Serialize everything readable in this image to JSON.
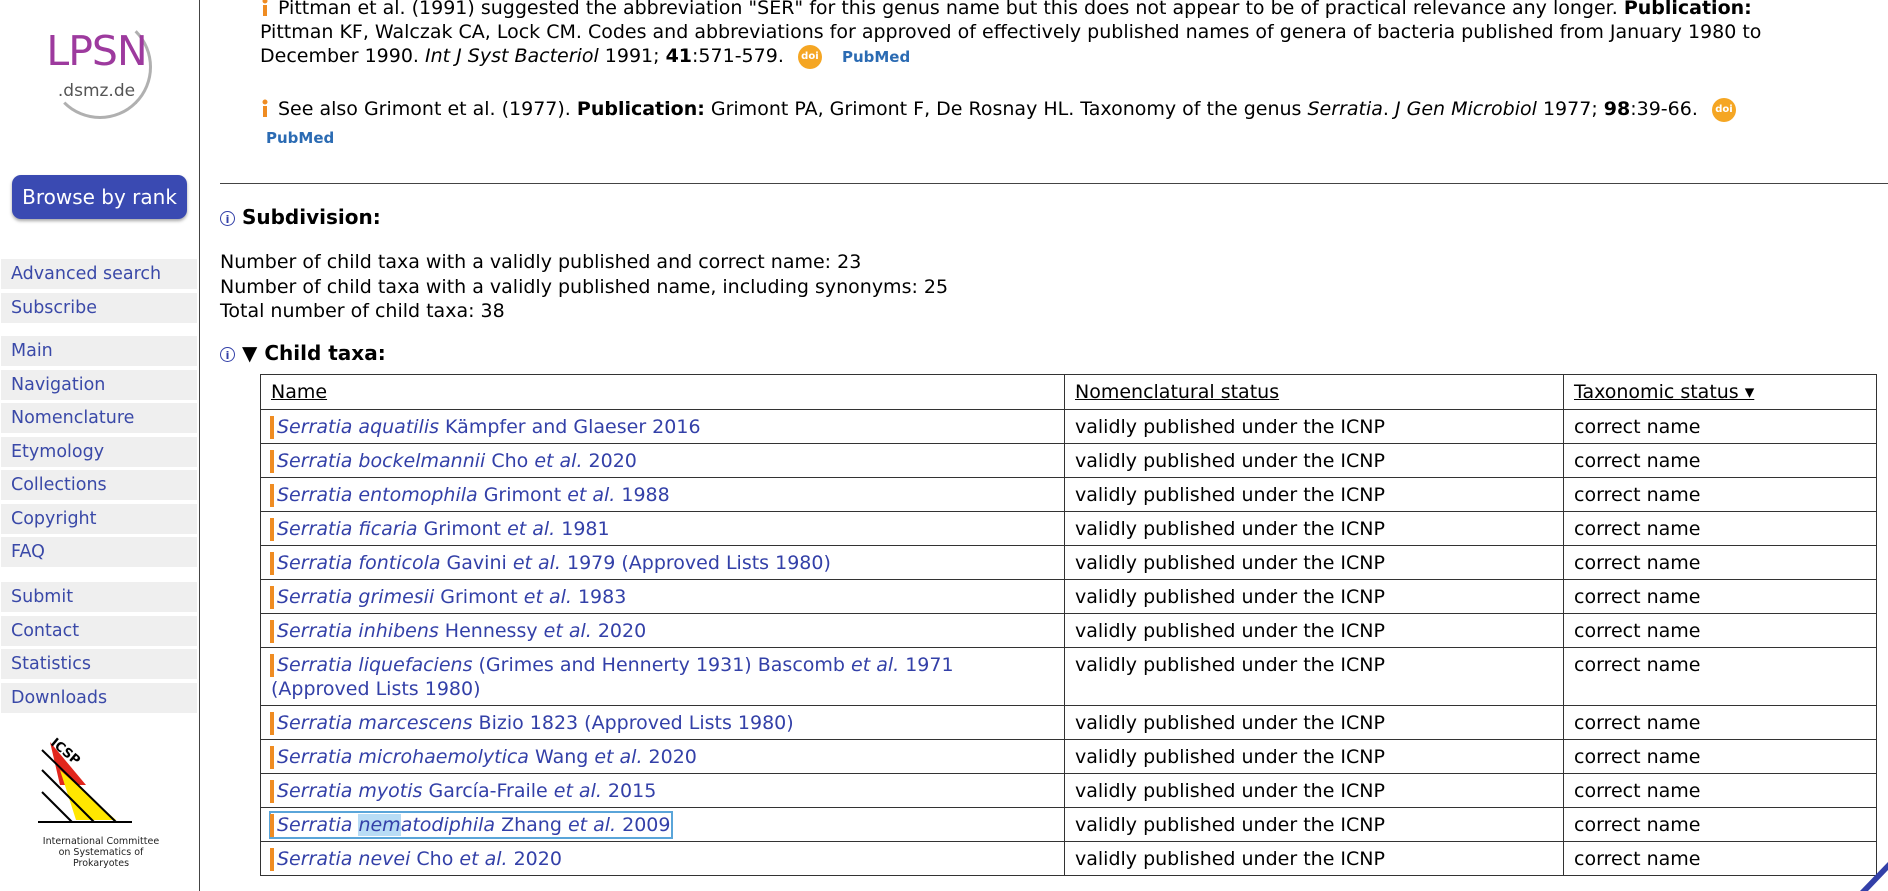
{
  "sidebar": {
    "logo_text": "LPSN",
    "logo_sub": ".dsmz.de",
    "browse_button": "Browse by rank",
    "groups": [
      [
        "Advanced search",
        "Subscribe"
      ],
      [
        "Main",
        "Navigation",
        "Nomenclature",
        "Etymology",
        "Collections",
        "Copyright",
        "FAQ"
      ],
      [
        "Submit",
        "Contact",
        "Statistics",
        "Downloads"
      ]
    ],
    "icsp_logo_text": "ICSP",
    "icsp_caption": "International Committee on Systematics of Prokaryotes"
  },
  "notes": [
    {
      "pre": "Pittman et al. (1991) suggested the abbreviation \"SER\" for this genus name but this does not appear to be of practical relevance any longer. ",
      "pub_label": "Publication:",
      "line2": "Pittman KF, Walczak CA, Lock CM. Codes and abbreviations for approved of effectively published names of genera of bacteria published from January 1980 to",
      "line3_pre": "December 1990. ",
      "journal": "Int J Syst Bacteriol",
      "year": " 1991; ",
      "volume": "41",
      "pages": ":571-579.",
      "doi": "doi",
      "pubmed": "PubMed"
    },
    {
      "pre": "See also Grimont et al. (1977). ",
      "pub_label": "Publication:",
      "authors": " Grimont PA, Grimont F, De Rosnay HL. Taxonomy of the genus ",
      "genus": "Serratia",
      "dot": ". ",
      "journal": "J Gen Microbiol",
      "year": " 1977; ",
      "volume": "98",
      "pages": ":39-66.",
      "doi": "doi",
      "pubmed": "PubMed"
    }
  ],
  "subdivision": {
    "title": "Subdivision:",
    "counts": [
      "Number of child taxa with a validly published and correct name: 23",
      "Number of child taxa with a validly published name, including synonyms: 25",
      "Total number of child taxa: 38"
    ]
  },
  "child_taxa": {
    "title": "Child taxa:",
    "toggle": "▼",
    "headers": [
      "Name",
      "Nomenclatural status",
      "Taxonomic status ▾"
    ],
    "rows": [
      {
        "sp": "Serratia aquatilis",
        "auth": " Kämpfer and Glaeser 2016",
        "nom": "validly published under the ICNP",
        "tax": "correct name"
      },
      {
        "sp": "Serratia bockelmannii",
        "auth": " Cho ",
        "etal": "et al.",
        "yr": " 2020",
        "nom": "validly published under the ICNP",
        "tax": "correct name"
      },
      {
        "sp": "Serratia entomophila",
        "auth": " Grimont ",
        "etal": "et al.",
        "yr": " 1988",
        "nom": "validly published under the ICNP",
        "tax": "correct name"
      },
      {
        "sp": "Serratia ficaria",
        "auth": " Grimont ",
        "etal": "et al.",
        "yr": " 1981",
        "nom": "validly published under the ICNP",
        "tax": "correct name"
      },
      {
        "sp": "Serratia fonticola",
        "auth": " Gavini ",
        "etal": "et al.",
        "yr": " 1979 (Approved Lists 1980)",
        "nom": "validly published under the ICNP",
        "tax": "correct name"
      },
      {
        "sp": "Serratia grimesii",
        "auth": " Grimont ",
        "etal": "et al.",
        "yr": " 1983",
        "nom": "validly published under the ICNP",
        "tax": "correct name"
      },
      {
        "sp": "Serratia inhibens",
        "auth": " Hennessy ",
        "etal": "et al.",
        "yr": " 2020",
        "nom": "validly published under the ICNP",
        "tax": "correct name"
      },
      {
        "sp": "Serratia liquefaciens",
        "auth": " (Grimes and Hennerty 1931) Bascomb ",
        "etal": "et al.",
        "yr": " 1971",
        "line2": "(Approved Lists 1980)",
        "nom": "validly published under the ICNP",
        "tax": "correct name"
      },
      {
        "sp": "Serratia marcescens",
        "auth": " Bizio 1823 (Approved Lists 1980)",
        "nom": "validly published under the ICNP",
        "tax": "correct name"
      },
      {
        "sp": "Serratia microhaemolytica",
        "auth": " Wang ",
        "etal": "et al.",
        "yr": " 2020",
        "nom": "validly published under the ICNP",
        "tax": "correct name"
      },
      {
        "sp": "Serratia myotis",
        "auth": " García-Fraile ",
        "etal": "et al.",
        "yr": " 2015",
        "nom": "validly published under the ICNP",
        "tax": "correct name"
      },
      {
        "sp_a": "Serratia ",
        "sp_hl": "nem",
        "sp_b": "atodiphila",
        "auth": " Zhang ",
        "etal": "et al.",
        "yr": " 2009",
        "nom": "validly published under the ICNP",
        "tax": "correct name",
        "selected": true
      },
      {
        "sp": "Serratia nevei",
        "auth": " Cho ",
        "etal": "et al.",
        "yr": " 2020",
        "nom": "validly published under the ICNP",
        "tax": "correct name"
      }
    ]
  },
  "colors": {
    "link": "#3340a8",
    "button_bg": "#3a4ab2",
    "logo_purple": "#9d3a9e",
    "accent_bar": "#ef8c22",
    "doi_badge": "#f5a623",
    "selection": "#b8dcf5"
  }
}
